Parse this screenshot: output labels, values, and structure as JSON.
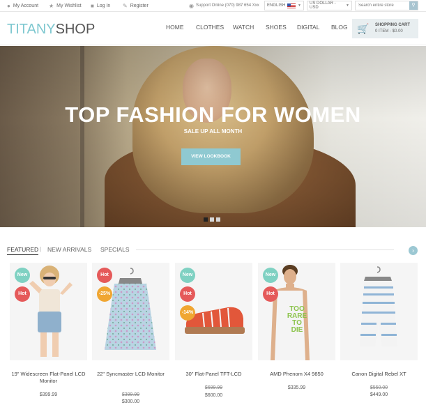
{
  "topbar": {
    "my_account": "My Account",
    "wishlist": "My Wishlist",
    "login": "Log In",
    "register": "Register",
    "support": "Support Online (070) 987 654 Xxx",
    "language": "ENGLISH",
    "currency": "US DOLLAR - USD",
    "search_placeholder": "Search entire store"
  },
  "header": {
    "logo_a": "TITANY",
    "logo_b": "SHOP",
    "nav": [
      "HOME",
      "CLOTHES",
      "WATCH",
      "SHOES",
      "DIGITAL",
      "BLOG"
    ],
    "cart_title": "SHOPPING CART",
    "cart_summary": "0 ITEM - $0.00"
  },
  "hero": {
    "title": "TOP FASHION FOR WOMEN",
    "subtitle": "SALE UP ALL MONTH",
    "button": "VIEW LOOKBOOK",
    "slide_count": 3,
    "active_slide": 1
  },
  "tabs": [
    "FEATURED",
    "NEW ARRIVALS",
    "SPECIALS"
  ],
  "tab_separator": "|",
  "colors": {
    "accent": "#8fc9d1",
    "new_badge": "#7fd1c2",
    "hot_badge": "#e55a5a",
    "sale_badge": "#f0a632"
  },
  "products": [
    {
      "name": "19\" Widescreen Flat-Panel LCD Monitor",
      "badges": [
        "New",
        "Hot"
      ],
      "price": "$399.99",
      "old_price": ""
    },
    {
      "name": "22\" Syncmaster LCD Monitor",
      "badges": [
        "Hot",
        "-25%"
      ],
      "price": "$300.00",
      "old_price": "$399.99"
    },
    {
      "name": "30\" Flat-Panel TFT-LCD",
      "badges": [
        "New",
        "Hot",
        "-14%"
      ],
      "price": "$600.00",
      "old_price": "$699.99"
    },
    {
      "name": "AMD Phenom X4 9850",
      "badges": [
        "New",
        "Hot"
      ],
      "price": "$335.99",
      "old_price": ""
    },
    {
      "name": "Canon Digital Rebel XT",
      "badges": [],
      "price": "$449.00",
      "old_price": "$550.00"
    }
  ],
  "tshirt_text": [
    "TOO",
    "RARE",
    "TO",
    "DIE"
  ],
  "icons": [
    "user-icon",
    "star-icon",
    "lock-icon",
    "pencil-icon",
    "headset-icon",
    "search-icon",
    "cart-icon",
    "chevron-right-icon"
  ]
}
